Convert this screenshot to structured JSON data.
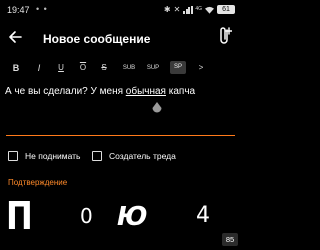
{
  "status_bar": {
    "time": "19:47",
    "indicator_dots": "• •",
    "network_label": "4G",
    "battery_level": "61"
  },
  "toolbar": {
    "title": "Новое сообщение"
  },
  "format_bar": {
    "bold": "B",
    "italic": "I",
    "underline": "U",
    "overline": "O",
    "strikethrough": "S",
    "subscript": "SUB",
    "superscript": "SUP",
    "spoiler": "SP",
    "more": ">"
  },
  "editor": {
    "text_before": "А че вы сделали? У меня ",
    "text_underlined": "обычная",
    "text_after": " капча"
  },
  "options": {
    "no_bump_label": "Не поднимать",
    "thread_creator_label": "Создатель треда"
  },
  "confirmation": {
    "label": "Подтверждение"
  },
  "captcha": {
    "chars": [
      "П",
      "0",
      "Ю",
      "4"
    ],
    "countdown": "85"
  },
  "colors": {
    "background": "#000000",
    "accent": "#ff7a1a",
    "text": "#ffffff"
  }
}
